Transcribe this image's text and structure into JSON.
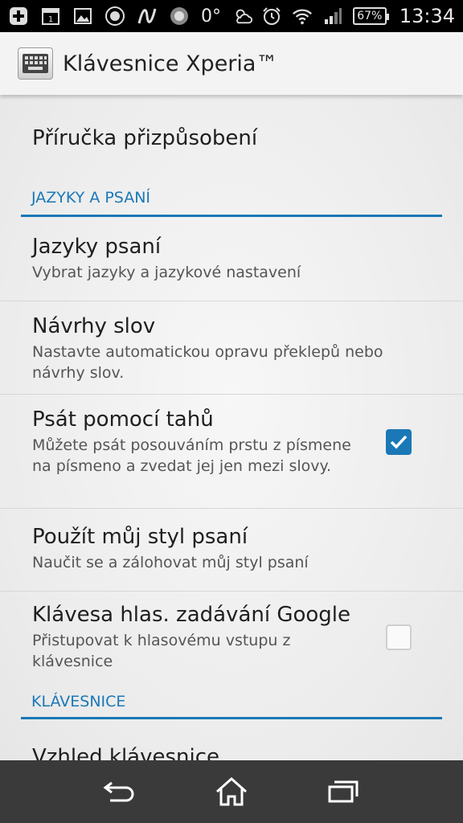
{
  "status_bar": {
    "temperature": "0°",
    "battery": "67%",
    "time": "13:34"
  },
  "action_bar": {
    "title": "Klávesnice Xperia™"
  },
  "prefs": {
    "customization_guide": {
      "title": "Příručka přizpůsobení"
    },
    "cat_languages": "JAZYKY A PSANÍ",
    "typing_languages": {
      "title": "Jazyky psaní",
      "summary": "Vybrat jazyky a jazykové nastavení"
    },
    "word_suggestions": {
      "title": "Návrhy slov",
      "summary": "Nastavte automatickou opravu překlepů nebo návrhy slov."
    },
    "gesture_input": {
      "title": "Psát pomocí tahů",
      "summary": "Můžete psát posouváním prstu z písmene na písmeno a zvedat jej jen mezi slovy.",
      "checked": true
    },
    "my_writing_style": {
      "title": "Použít můj styl psaní",
      "summary": "Naučit se a zálohovat můj styl psaní"
    },
    "google_voice_key": {
      "title": "Klávesa hlas. zadávání Google",
      "summary": "Přistupovat k hlasovému vstupu z klávesnice",
      "checked": false
    },
    "cat_keyboard": "KLÁVESNICE",
    "partial_item": {
      "title": "Vzhled klávesnice"
    }
  },
  "colors": {
    "accent": "#1a78b6",
    "status_bar": "#000000",
    "nav_bar": "#3a3a3a"
  },
  "nav": {
    "back": "back-icon",
    "home": "home-icon",
    "recents": "recents-icon"
  }
}
